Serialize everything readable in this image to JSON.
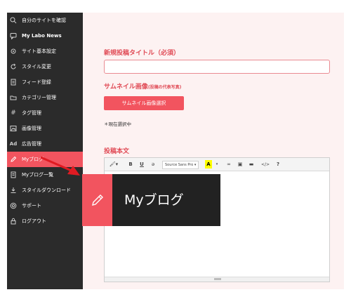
{
  "sidebar": {
    "items": [
      {
        "icon": "search-icon",
        "label": "自分のサイトを確認"
      },
      {
        "icon": "chat-icon",
        "label": "My Labo News"
      },
      {
        "icon": "gear-icon",
        "label": "サイト基本設定"
      },
      {
        "icon": "refresh-icon",
        "label": "スタイル変更"
      },
      {
        "icon": "document-icon",
        "label": "フィード登録"
      },
      {
        "icon": "folder-icon",
        "label": "カテゴリー管理"
      },
      {
        "icon": "hash-icon",
        "label": "タグ管理"
      },
      {
        "icon": "image-icon",
        "label": "画像管理"
      },
      {
        "icon": "ad-icon",
        "label": "広告管理"
      },
      {
        "icon": "pencil-icon",
        "label": "Myブログ"
      },
      {
        "icon": "list-icon",
        "label": "Myブログ一覧"
      },
      {
        "icon": "download-icon",
        "label": "スタイルダウンロード"
      },
      {
        "icon": "support-icon",
        "label": "サポート"
      },
      {
        "icon": "lock-icon",
        "label": "ログアウト"
      }
    ],
    "active_index": 9,
    "icon_glyph_ad": "Ad",
    "icon_glyph_hash": "#"
  },
  "form": {
    "title_label": "新規投稿タイトル（必須）",
    "thumbnail_label": "サムネイル画像",
    "thumbnail_sub": "(投稿の代表写真)",
    "thumbnail_button": "サムネイル画像選択",
    "no_selection": "＊現在選択中",
    "body_label": "投稿本文"
  },
  "editor": {
    "toolbar": {
      "style": "🖌▾",
      "bold": "B",
      "underline": "U",
      "clear": "ǝ",
      "font": "Source Sans Pro ▾",
      "color": "A",
      "color_caret": "▾",
      "link": "∞",
      "image": "▣",
      "video": "▬",
      "code": "</>",
      "help": "?"
    }
  },
  "callout": {
    "text": "Myブログ"
  },
  "colors": {
    "accent": "#f2545f",
    "sidebar_bg": "#2b2b2b",
    "main_bg": "#fdf2f2",
    "arrow": "#e01b22"
  }
}
